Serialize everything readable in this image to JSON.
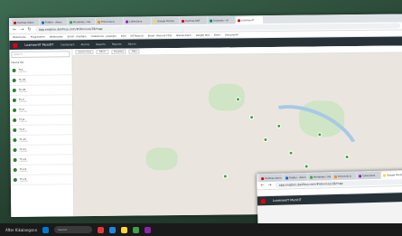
{
  "browser": {
    "tabs": [
      {
        "label": "Danfoss Alsen",
        "color": "#e2000f"
      },
      {
        "label": "Fiddler - Alsen",
        "color": "#1565c0"
      },
      {
        "label": "Mendeley / Ale",
        "color": "#43a047"
      },
      {
        "label": "Protocols.io",
        "color": "#fb8c00"
      },
      {
        "label": "Collections",
        "color": "#8e24aa"
      },
      {
        "label": "Google Photos",
        "color": "#fdd835"
      },
      {
        "label": "Danfoss ENT",
        "color": "#e2000f"
      },
      {
        "label": "Datasets - Al",
        "color": "#00897b"
      },
      {
        "label": "LoamsenIT",
        "color": "#e2000f"
      }
    ],
    "url": "app.ensplex.danfoss.com/#/devices/18/map",
    "bookmarks": [
      "Bookmarks",
      "Programmer",
      "Webmaster",
      "Email - Prestigio",
      "Collections - prestigio",
      "Intel",
      "SIT-Natural",
      "Email - Natural-Chat",
      "Nakula-Diam",
      "Google Hire",
      "Enter",
      "DiscoverAll"
    ]
  },
  "app": {
    "name": "LoamsenIT MonitIT",
    "menu": [
      "Dashboard",
      "Alarms",
      "Reports",
      "Reports",
      "Admin"
    ]
  },
  "sidebar": {
    "search_placeholder": "Search",
    "header": "Device list",
    "devices": [
      {
        "name": "TC1",
        "sub": "Loamsen"
      },
      {
        "name": "TC-03",
        "sub": "Loamsen"
      },
      {
        "name": "TC-04",
        "sub": "Loamsen"
      },
      {
        "name": "TC-5",
        "sub": "Loamsen"
      },
      {
        "name": "TC-6",
        "sub": "Loamsen"
      },
      {
        "name": "TC-8",
        "sub": "Loamsen"
      },
      {
        "name": "TC-9",
        "sub": "Loamsen"
      },
      {
        "name": "TC-10",
        "sub": "Loamsen"
      },
      {
        "name": "TC-11",
        "sub": "Loamsen"
      },
      {
        "name": "TC-12",
        "sub": "Loamsen"
      },
      {
        "name": "TC-13",
        "sub": "Loamsen"
      },
      {
        "name": "TC-14",
        "sub": "Loamsen"
      }
    ]
  },
  "map": {
    "tools": [
      "Search Area",
      "Filters",
      "Favorites",
      "Filter"
    ]
  },
  "taskbar": {
    "weather": "After Kikalangsnn",
    "search_placeholder": "Search"
  }
}
